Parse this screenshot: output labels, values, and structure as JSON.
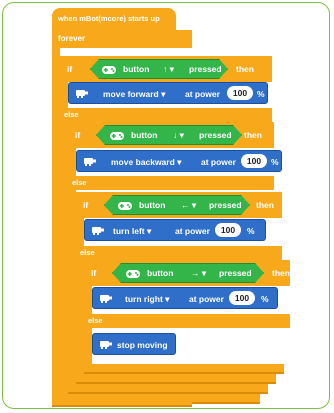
{
  "hat": {
    "label": "when mBot(mcore) starts up"
  },
  "forever": {
    "label": "forever"
  },
  "branches": [
    {
      "if_label": "if",
      "condition": {
        "button_label": "button",
        "direction": "↑ ▾",
        "pressed_label": "pressed"
      },
      "then_label": "then",
      "action": {
        "label": "move forward ▾",
        "at_power_label": "at power",
        "power": "100",
        "unit": "%"
      }
    },
    {
      "if_label": "if",
      "condition": {
        "button_label": "button",
        "direction": "↓ ▾",
        "pressed_label": "pressed"
      },
      "then_label": "then",
      "action": {
        "label": "move backward ▾",
        "at_power_label": "at power",
        "power": "100",
        "unit": "%"
      }
    },
    {
      "if_label": "if",
      "condition": {
        "button_label": "button",
        "direction": "← ▾",
        "pressed_label": "pressed"
      },
      "then_label": "then",
      "action": {
        "label": "turn left ▾",
        "at_power_label": "at power",
        "power": "100",
        "unit": "%"
      }
    },
    {
      "if_label": "if",
      "condition": {
        "button_label": "button",
        "direction": "→ ▾",
        "pressed_label": "pressed"
      },
      "then_label": "then",
      "action": {
        "label": "turn right ▾",
        "at_power_label": "at power",
        "power": "100",
        "unit": "%"
      }
    }
  ],
  "else_labels": [
    "else",
    "else",
    "else",
    "else"
  ],
  "stop": {
    "label": "stop moving"
  },
  "colors": {
    "control": "#f7a81b",
    "sensing": "#33b54a",
    "motion": "#2f6ec9",
    "frame": "#7cc242"
  },
  "icons": {
    "gamepad": "gamepad-icon",
    "motor": "motor-icon"
  }
}
